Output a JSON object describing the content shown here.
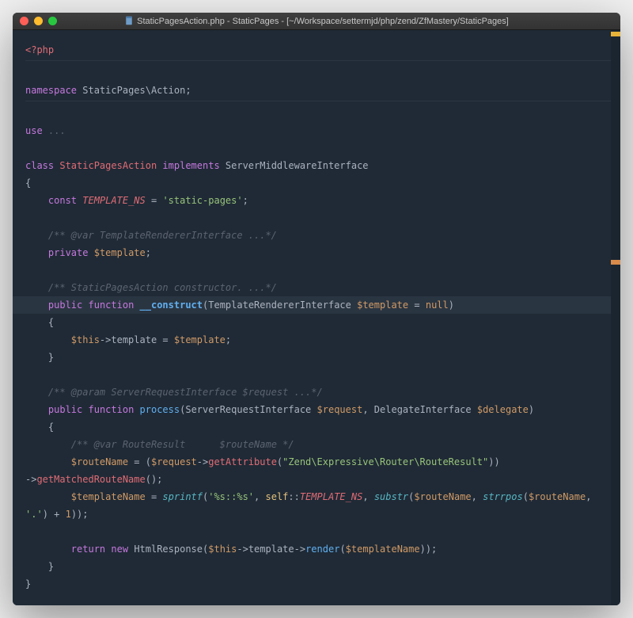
{
  "window": {
    "title": "StaticPagesAction.php - StaticPages - [~/Workspace/settermjd/php/zend/ZfMastery/StaticPages]"
  },
  "code": {
    "php_open": "<?php",
    "ns_kw": "namespace",
    "ns_name": "StaticPages\\Action",
    "use_kw": "use",
    "use_fold": "...",
    "class_kw": "class",
    "class_name": "StaticPagesAction",
    "implements_kw": "implements",
    "interface_name": "ServerMiddlewareInterface",
    "const_kw": "const",
    "const_name": "TEMPLATE_NS",
    "const_val": "'static-pages'",
    "cmt_template": "/** @var TemplateRendererInterface ...*/",
    "private_kw": "private",
    "var_template": "$template",
    "cmt_ctor": "/** StaticPagesAction constructor. ...*/",
    "public_kw": "public",
    "function_kw": "function",
    "ctor_name": "__construct",
    "ctor_param_type": "TemplateRendererInterface",
    "ctor_param_var": "$template",
    "null_kw": "null",
    "this_kw": "$this",
    "prop_template": "template",
    "cmt_process": "/** @param ServerRequestInterface $request ...*/",
    "process_name": "process",
    "process_p1_type": "ServerRequestInterface",
    "process_p1_var": "$request",
    "process_p2_type": "DelegateInterface",
    "process_p2_var": "$delegate",
    "cmt_routeresult_a": "/** @var",
    "cmt_routeresult_b": "RouteResult",
    "cmt_routeresult_c": "$routeName */",
    "var_routename": "$routeName",
    "var_request": "$request",
    "getattr": "getAttribute",
    "getattr_arg": "\"Zend\\Expressive\\Router\\RouteResult\"",
    "getmatched": "getMatchedRouteName",
    "var_templatename": "$templateName",
    "sprintf": "sprintf",
    "sprintf_fmt": "'%s::%s'",
    "self_kw": "self",
    "self_const": "TEMPLATE_NS",
    "substr": "substr",
    "strrpos": "strrpos",
    "dot_str": "'.'",
    "plus_one": "1",
    "return_kw": "return",
    "new_kw": "new",
    "response_cls": "HtmlResponse",
    "render": "render"
  }
}
